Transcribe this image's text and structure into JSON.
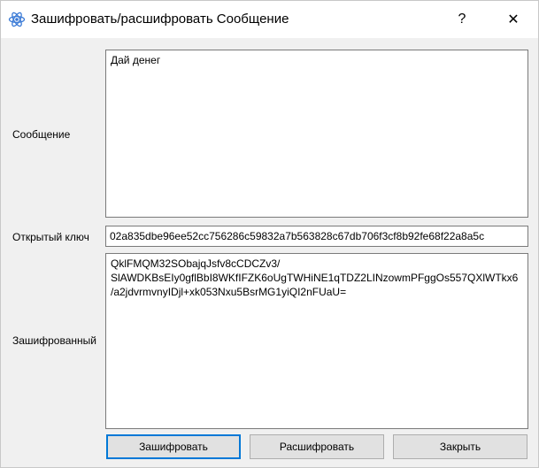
{
  "window": {
    "title": "Зашифровать/расшифровать Сообщение",
    "help_glyph": "?",
    "close_glyph": "✕"
  },
  "form": {
    "message_label": "Сообщение",
    "message_value": "Дай денег",
    "public_key_label": "Открытый ключ",
    "public_key_value": "02a835dbe96ee52cc756286c59832a7b563828c67db706f3cf8b92fe68f22a8a5c",
    "encrypted_label": "Зашифрованный",
    "encrypted_value": "QklFMQM32SObajqJsfv8cCDCZv3/\nSlAWDKBsEIy0gflBbI8WKfIFZK6oUgTWHiNE1qTDZ2LINzowmPFggOs557QXlWTkx6\n/a2jdvrmvnyIDjl+xk053Nxu5BsrMG1yiQI2nFUaU="
  },
  "buttons": {
    "encrypt": "Зашифровать",
    "decrypt": "Расшифровать",
    "close": "Закрыть"
  },
  "colors": {
    "accent": "#0078d7",
    "app_icon": "#3a7ad6"
  }
}
